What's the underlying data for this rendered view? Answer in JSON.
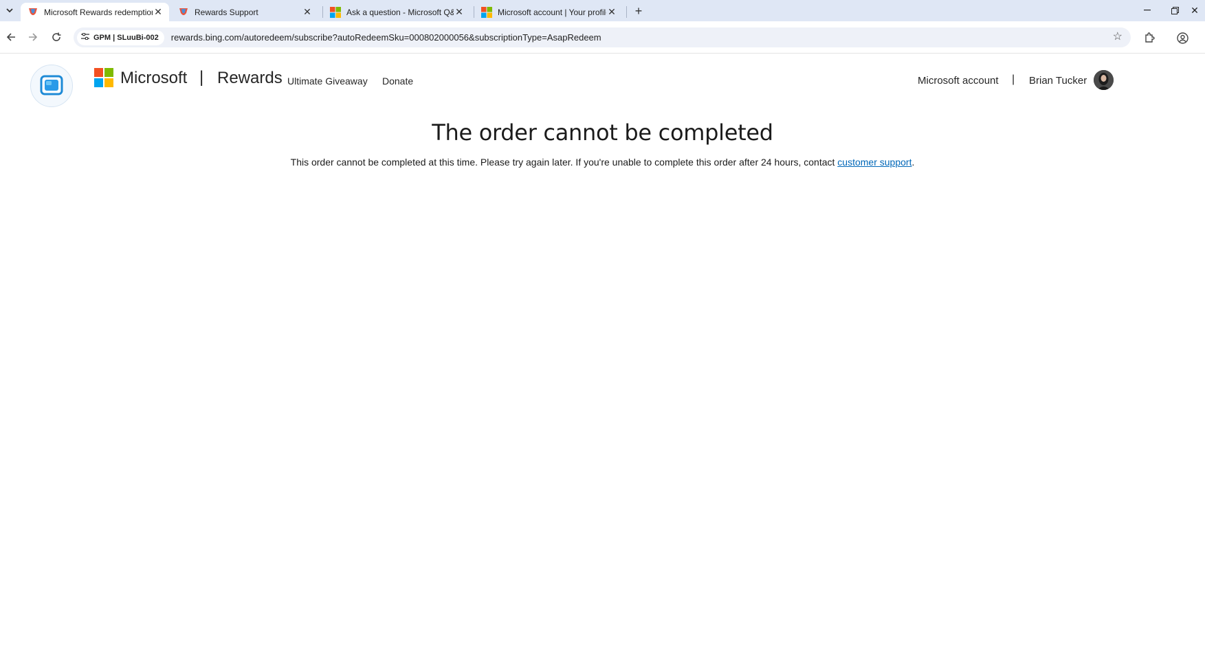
{
  "browser": {
    "tabs": [
      {
        "title": "Microsoft Rewards redemption",
        "favicon": "rewards-favicon",
        "active": true
      },
      {
        "title": "Rewards Support",
        "favicon": "rewards-favicon",
        "active": false
      },
      {
        "title": "Ask a question - Microsoft Q&A",
        "favicon": "microsoft-favicon",
        "active": false
      },
      {
        "title": "Microsoft account | Your profile",
        "favicon": "microsoft-favicon",
        "active": false
      }
    ],
    "profile_chip": "GPM | SLuuBi-002",
    "url": "rewards.bing.com/autoredeem/subscribe?autoRedeemSku=000802000056&subscriptionType=AsapRedeem"
  },
  "header": {
    "brand": "Microsoft",
    "separator": "|",
    "product": "Rewards",
    "nav": [
      "Ultimate Giveaway",
      "Donate"
    ],
    "account_link": "Microsoft account",
    "account_separator": "|",
    "user_name": "Brian Tucker"
  },
  "main": {
    "heading": "The order cannot be completed",
    "message_prefix": "This order cannot be completed at this time. Please try again later. If you're unable to complete this order after 24 hours, contact ",
    "message_link": "customer support",
    "message_suffix": "."
  },
  "colors": {
    "ms_red": "#f25022",
    "ms_green": "#7fba00",
    "ms_blue": "#00a4ef",
    "ms_yellow": "#ffb900",
    "link": "#0067b8",
    "tabbar": "#dfe7f5"
  }
}
